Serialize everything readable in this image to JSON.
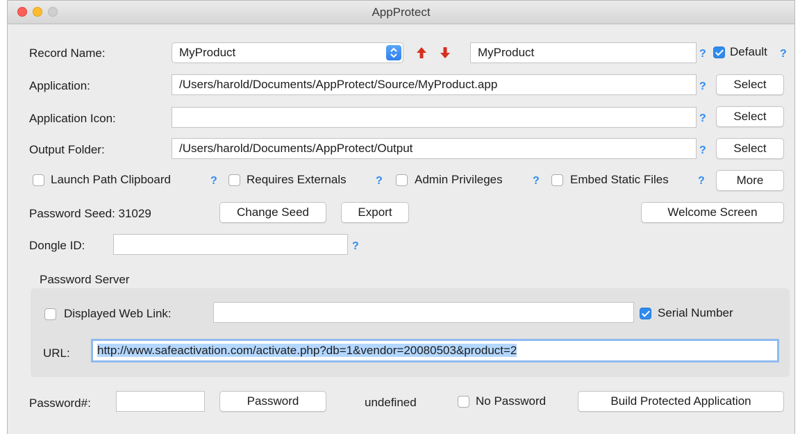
{
  "window": {
    "title": "AppProtect"
  },
  "record": {
    "label": "Record Name:",
    "selected": "MyProduct",
    "name_value": "MyProduct",
    "default_label": "Default",
    "default_checked": true
  },
  "application": {
    "label": "Application:",
    "value": "/Users/harold/Documents/AppProtect/Source/MyProduct.app",
    "select_label": "Select"
  },
  "app_icon": {
    "label": "Application Icon:",
    "value": "",
    "select_label": "Select"
  },
  "output": {
    "label": "Output Folder:",
    "value": "/Users/harold/Documents/AppProtect/Output",
    "select_label": "Select"
  },
  "options": {
    "launch_path": "Launch Path Clipboard",
    "requires_externals": "Requires Externals",
    "admin_privileges": "Admin Privileges",
    "embed_static": "Embed Static Files",
    "more_label": "More"
  },
  "seed": {
    "label": "Password Seed: 31029",
    "change_label": "Change Seed",
    "export_label": "Export",
    "welcome_label": "Welcome Screen"
  },
  "dongle": {
    "label": "Dongle ID:",
    "value": ""
  },
  "password_server": {
    "title": "Password Server",
    "web_link_label": "Displayed Web Link:",
    "web_link_value": "",
    "serial_label": "Serial Number",
    "serial_checked": true,
    "url_label": "URL:",
    "url_value": "http://www.safeactivation.com/activate.php?db=1&vendor=20080503&product=2"
  },
  "footer": {
    "password_num_label": "Password#:",
    "password_num_value": "",
    "password_button": "Password",
    "status": "undefined",
    "no_password_label": "No Password",
    "build_label": "Build Protected Application"
  },
  "help_glyph": "?",
  "colors": {
    "accent": "#2f8bf0",
    "arrow_red": "#d62e1f",
    "selection": "#b3d7ff"
  }
}
